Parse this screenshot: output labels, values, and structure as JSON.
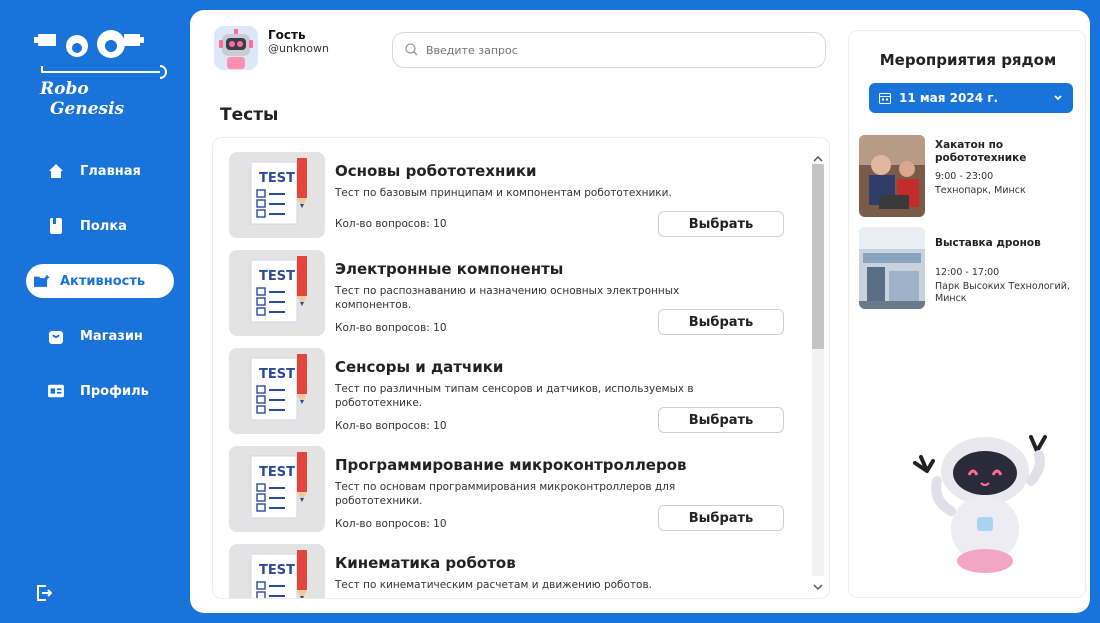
{
  "brand": {
    "line1": "Robo",
    "line2": "Genesis"
  },
  "nav": {
    "items": [
      {
        "label": "Главная",
        "icon": "home-icon"
      },
      {
        "label": "Полка",
        "icon": "bookmark-icon"
      },
      {
        "label": "Активность",
        "icon": "folder-icon",
        "active": true
      },
      {
        "label": "Магазин",
        "icon": "bag-icon"
      },
      {
        "label": "Профиль",
        "icon": "id-card-icon"
      }
    ]
  },
  "user": {
    "name": "Гость",
    "handle": "@unknown"
  },
  "search": {
    "placeholder": "Введите запрос"
  },
  "page": {
    "title": "Тесты"
  },
  "tests": [
    {
      "title": "Основы робототехники",
      "desc": "Тест по базовым принципам и компонентам робототехники.",
      "count": "Кол-во вопросов:  10",
      "button": "Выбрать"
    },
    {
      "title": "Электронные компоненты",
      "desc": "Тест по распознаванию и назначению основных электронных компонентов.",
      "count": "Кол-во вопросов:  10",
      "button": "Выбрать"
    },
    {
      "title": "Сенсоры и датчики",
      "desc": "Тест по различным типам сенсоров и датчиков, используемых в робототехнике.",
      "count": "Кол-во вопросов:  10",
      "button": "Выбрать"
    },
    {
      "title": "Программирование микроконтроллеров",
      "desc": "Тест по основам программирования микроконтроллеров для робототехники.",
      "count": "Кол-во вопросов:  10",
      "button": "Выбрать"
    },
    {
      "title": "Кинематика роботов",
      "desc": "Тест по кинематическим расчетам и движению роботов.",
      "count": "",
      "button": ""
    }
  ],
  "thumb_label": "TEST",
  "events": {
    "title": "Мероприятия рядом",
    "date": "11 мая 2024 г.",
    "items": [
      {
        "title": "Хакатон по робототехнике",
        "time": "9:00  - 23:00",
        "place": "Технопарк, Минск"
      },
      {
        "title": "Выставка дронов",
        "time": "12:00  - 17:00",
        "place": "Парк Высоких Технологий, Минск"
      }
    ]
  },
  "colors": {
    "accent": "#1a73d8",
    "panel": "#ffffff"
  }
}
